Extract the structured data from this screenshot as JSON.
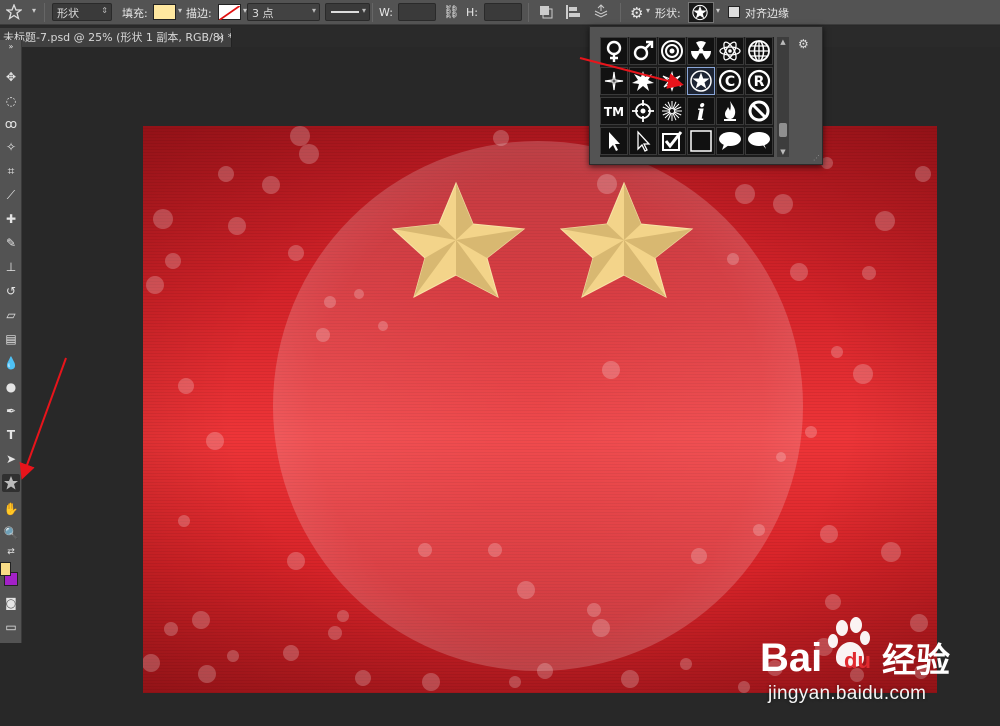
{
  "options_bar": {
    "mode_value": "形状",
    "fill_label": "填充:",
    "fill_color": "#ffe8a0",
    "stroke_label": "描边:",
    "stroke_width_value": "3 点",
    "width_label": "W:",
    "width_value": "",
    "height_label": "H:",
    "height_value": "",
    "shape_label": "形状:",
    "align_edges_label": "对齐边缘",
    "align_edges_checked": false
  },
  "document_tab": {
    "title": "未标题-7.psd @ 25% (形状 1 副本, RGB/8) *",
    "close_glyph": "×"
  },
  "tools": {
    "foreground_color": "#f9dc86",
    "background_color": "#a321c8",
    "active_tool": "custom-shape-tool"
  },
  "canvas": {
    "background_color": "#e02a2f",
    "star_color": "#f3d48a"
  },
  "shape_picker": {
    "selected_shape": "star-on-circle",
    "rows": [
      [
        "female-sign",
        "male-sign",
        "target",
        "radiation",
        "atom",
        "globe"
      ],
      [
        "compass-spark",
        "burst",
        "splat",
        "star-on-circle",
        "copyright",
        "registered"
      ],
      [
        "trademark",
        "crosshair",
        "sunburst",
        "info",
        "fire",
        "no-sign"
      ],
      [
        "pointer-arrow",
        "pointer-outline",
        "checkbox-check",
        "square",
        "speech-bubble",
        "thought-bubble"
      ]
    ],
    "trademark_text": "TM",
    "info_text": "i",
    "copyright_text": "C",
    "registered_text": "R"
  },
  "watermark": {
    "logo_text_bai": "Bai",
    "logo_text_du": "du",
    "logo_text_cn": "经验",
    "url": "jingyan.baidu.com"
  }
}
